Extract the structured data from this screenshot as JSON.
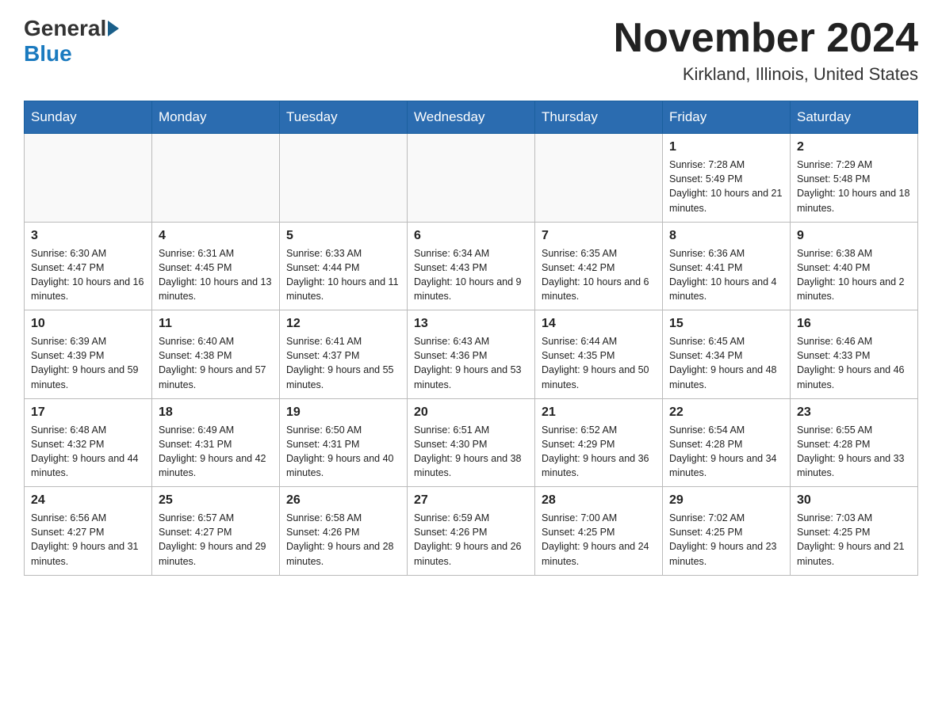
{
  "header": {
    "logo_general": "General",
    "logo_blue": "Blue",
    "month_year": "November 2024",
    "location": "Kirkland, Illinois, United States"
  },
  "days_of_week": [
    "Sunday",
    "Monday",
    "Tuesday",
    "Wednesday",
    "Thursday",
    "Friday",
    "Saturday"
  ],
  "weeks": [
    [
      {
        "day": "",
        "sunrise": "",
        "sunset": "",
        "daylight": ""
      },
      {
        "day": "",
        "sunrise": "",
        "sunset": "",
        "daylight": ""
      },
      {
        "day": "",
        "sunrise": "",
        "sunset": "",
        "daylight": ""
      },
      {
        "day": "",
        "sunrise": "",
        "sunset": "",
        "daylight": ""
      },
      {
        "day": "",
        "sunrise": "",
        "sunset": "",
        "daylight": ""
      },
      {
        "day": "1",
        "sunrise": "Sunrise: 7:28 AM",
        "sunset": "Sunset: 5:49 PM",
        "daylight": "Daylight: 10 hours and 21 minutes."
      },
      {
        "day": "2",
        "sunrise": "Sunrise: 7:29 AM",
        "sunset": "Sunset: 5:48 PM",
        "daylight": "Daylight: 10 hours and 18 minutes."
      }
    ],
    [
      {
        "day": "3",
        "sunrise": "Sunrise: 6:30 AM",
        "sunset": "Sunset: 4:47 PM",
        "daylight": "Daylight: 10 hours and 16 minutes."
      },
      {
        "day": "4",
        "sunrise": "Sunrise: 6:31 AM",
        "sunset": "Sunset: 4:45 PM",
        "daylight": "Daylight: 10 hours and 13 minutes."
      },
      {
        "day": "5",
        "sunrise": "Sunrise: 6:33 AM",
        "sunset": "Sunset: 4:44 PM",
        "daylight": "Daylight: 10 hours and 11 minutes."
      },
      {
        "day": "6",
        "sunrise": "Sunrise: 6:34 AM",
        "sunset": "Sunset: 4:43 PM",
        "daylight": "Daylight: 10 hours and 9 minutes."
      },
      {
        "day": "7",
        "sunrise": "Sunrise: 6:35 AM",
        "sunset": "Sunset: 4:42 PM",
        "daylight": "Daylight: 10 hours and 6 minutes."
      },
      {
        "day": "8",
        "sunrise": "Sunrise: 6:36 AM",
        "sunset": "Sunset: 4:41 PM",
        "daylight": "Daylight: 10 hours and 4 minutes."
      },
      {
        "day": "9",
        "sunrise": "Sunrise: 6:38 AM",
        "sunset": "Sunset: 4:40 PM",
        "daylight": "Daylight: 10 hours and 2 minutes."
      }
    ],
    [
      {
        "day": "10",
        "sunrise": "Sunrise: 6:39 AM",
        "sunset": "Sunset: 4:39 PM",
        "daylight": "Daylight: 9 hours and 59 minutes."
      },
      {
        "day": "11",
        "sunrise": "Sunrise: 6:40 AM",
        "sunset": "Sunset: 4:38 PM",
        "daylight": "Daylight: 9 hours and 57 minutes."
      },
      {
        "day": "12",
        "sunrise": "Sunrise: 6:41 AM",
        "sunset": "Sunset: 4:37 PM",
        "daylight": "Daylight: 9 hours and 55 minutes."
      },
      {
        "day": "13",
        "sunrise": "Sunrise: 6:43 AM",
        "sunset": "Sunset: 4:36 PM",
        "daylight": "Daylight: 9 hours and 53 minutes."
      },
      {
        "day": "14",
        "sunrise": "Sunrise: 6:44 AM",
        "sunset": "Sunset: 4:35 PM",
        "daylight": "Daylight: 9 hours and 50 minutes."
      },
      {
        "day": "15",
        "sunrise": "Sunrise: 6:45 AM",
        "sunset": "Sunset: 4:34 PM",
        "daylight": "Daylight: 9 hours and 48 minutes."
      },
      {
        "day": "16",
        "sunrise": "Sunrise: 6:46 AM",
        "sunset": "Sunset: 4:33 PM",
        "daylight": "Daylight: 9 hours and 46 minutes."
      }
    ],
    [
      {
        "day": "17",
        "sunrise": "Sunrise: 6:48 AM",
        "sunset": "Sunset: 4:32 PM",
        "daylight": "Daylight: 9 hours and 44 minutes."
      },
      {
        "day": "18",
        "sunrise": "Sunrise: 6:49 AM",
        "sunset": "Sunset: 4:31 PM",
        "daylight": "Daylight: 9 hours and 42 minutes."
      },
      {
        "day": "19",
        "sunrise": "Sunrise: 6:50 AM",
        "sunset": "Sunset: 4:31 PM",
        "daylight": "Daylight: 9 hours and 40 minutes."
      },
      {
        "day": "20",
        "sunrise": "Sunrise: 6:51 AM",
        "sunset": "Sunset: 4:30 PM",
        "daylight": "Daylight: 9 hours and 38 minutes."
      },
      {
        "day": "21",
        "sunrise": "Sunrise: 6:52 AM",
        "sunset": "Sunset: 4:29 PM",
        "daylight": "Daylight: 9 hours and 36 minutes."
      },
      {
        "day": "22",
        "sunrise": "Sunrise: 6:54 AM",
        "sunset": "Sunset: 4:28 PM",
        "daylight": "Daylight: 9 hours and 34 minutes."
      },
      {
        "day": "23",
        "sunrise": "Sunrise: 6:55 AM",
        "sunset": "Sunset: 4:28 PM",
        "daylight": "Daylight: 9 hours and 33 minutes."
      }
    ],
    [
      {
        "day": "24",
        "sunrise": "Sunrise: 6:56 AM",
        "sunset": "Sunset: 4:27 PM",
        "daylight": "Daylight: 9 hours and 31 minutes."
      },
      {
        "day": "25",
        "sunrise": "Sunrise: 6:57 AM",
        "sunset": "Sunset: 4:27 PM",
        "daylight": "Daylight: 9 hours and 29 minutes."
      },
      {
        "day": "26",
        "sunrise": "Sunrise: 6:58 AM",
        "sunset": "Sunset: 4:26 PM",
        "daylight": "Daylight: 9 hours and 28 minutes."
      },
      {
        "day": "27",
        "sunrise": "Sunrise: 6:59 AM",
        "sunset": "Sunset: 4:26 PM",
        "daylight": "Daylight: 9 hours and 26 minutes."
      },
      {
        "day": "28",
        "sunrise": "Sunrise: 7:00 AM",
        "sunset": "Sunset: 4:25 PM",
        "daylight": "Daylight: 9 hours and 24 minutes."
      },
      {
        "day": "29",
        "sunrise": "Sunrise: 7:02 AM",
        "sunset": "Sunset: 4:25 PM",
        "daylight": "Daylight: 9 hours and 23 minutes."
      },
      {
        "day": "30",
        "sunrise": "Sunrise: 7:03 AM",
        "sunset": "Sunset: 4:25 PM",
        "daylight": "Daylight: 9 hours and 21 minutes."
      }
    ]
  ]
}
